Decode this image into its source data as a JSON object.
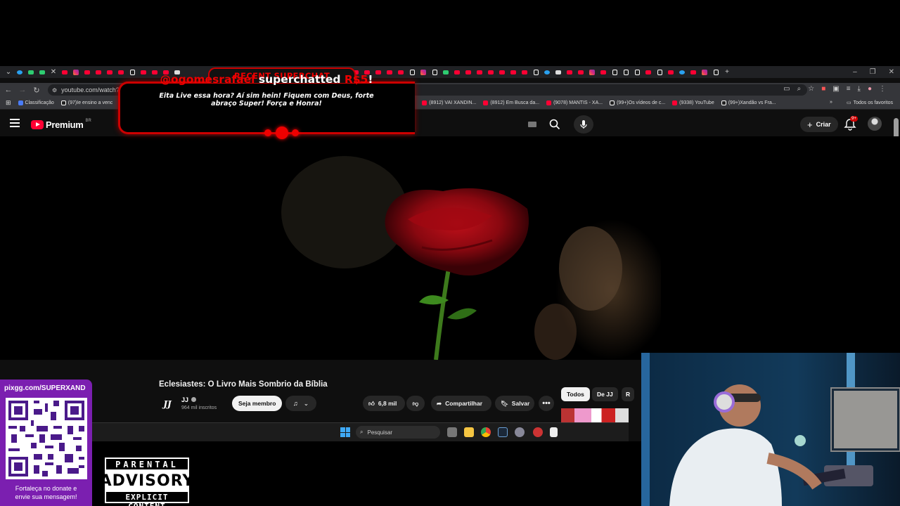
{
  "browser": {
    "url": "youtube.com/watch?v=",
    "bookmarks_left": [
      "Classificação",
      "(97)Ie ensino a venc"
    ],
    "bookmarks": [
      {
        "label": "(8912) VAI XANDIN...",
        "color": "#ff0033"
      },
      {
        "label": "(8912) Em Busca da...",
        "color": "#ff0033"
      },
      {
        "label": "(9078) MANTIS - XA...",
        "color": "#ff0033"
      },
      {
        "label": "(99+)Os vídeos de c...",
        "color": "#222222"
      },
      {
        "label": "(9338) YouTube",
        "color": "#ff0033"
      },
      {
        "label": "(99+)Xandão vs Fra...",
        "color": "#222222"
      }
    ],
    "all_bookmarks": "Todos os favoritos"
  },
  "youtube": {
    "logo": "Premium",
    "country": "BR",
    "create_label": "Criar",
    "notif_count": "9+",
    "video_title": "Eclesiastes: O Livro Mais Sombrio da Bíblia",
    "channel_initials": "JJ",
    "channel_name": "JJ",
    "subscribers": "964 mil inscritos",
    "member_label": "Seja membro",
    "likes": "6,8 mil",
    "share_label": "Compartilhar",
    "save_label": "Salvar",
    "chips": [
      "Todos",
      "De JJ",
      "R"
    ]
  },
  "taskbar": {
    "search_placeholder": "Pesquisar"
  },
  "superchat": {
    "header": "RECENT SUPERCHAT",
    "username": "@ogomesrafael",
    "action": "superchatted",
    "amount": "R$5",
    "bang": "!",
    "message": "Eita Live essa hora? Aí sim hein! Fiquem com Deus, forte abraço Super! Força e Honra!"
  },
  "pix": {
    "url": "pixgg.com/SUPERXAND",
    "message_line1": "Fortaleça no donate e",
    "message_line2": "envie sua mensagem!"
  },
  "advisory": {
    "top": "PARENTAL",
    "middle": "ADVISORY",
    "bottom": "EXPLICIT CONTENT"
  },
  "colors": {
    "brand_red": "#ff0033",
    "superchat_red": "#e00000",
    "pix_purple": "#7b1fb0"
  }
}
